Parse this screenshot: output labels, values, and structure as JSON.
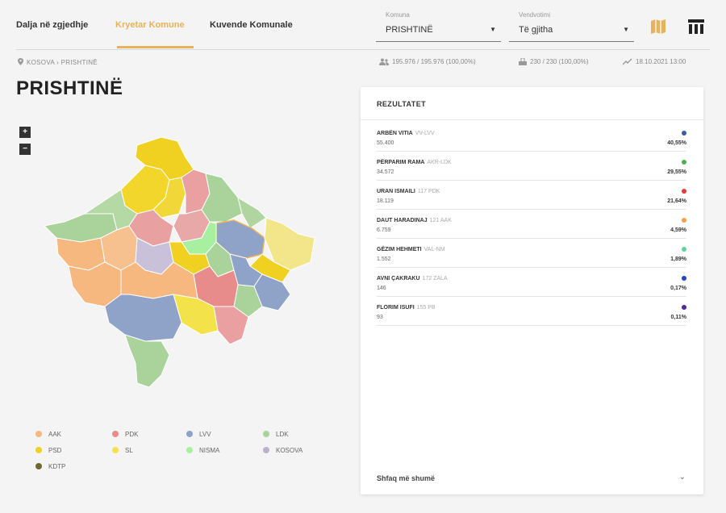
{
  "nav": {
    "tabs": [
      "Dalja në zgjedhje",
      "Kryetar Komune",
      "Kuvende Komunale"
    ],
    "active_tab": 1,
    "komuna": {
      "caption": "Komuna",
      "value": "PRISHTINË"
    },
    "vendvotimi": {
      "caption": "Vendvotimi",
      "value": "Të gjitha"
    },
    "map_icon": "map-icon",
    "table_icon": "table-icon"
  },
  "breadcrumb": "KOSOVA › PRISHTINË",
  "stats": {
    "voters": "195.976 / 195.976 (100,00%)",
    "stations": "230 / 230 (100,00%)",
    "updated": "18.10.2021 13:00"
  },
  "page_title": "PRISHTINË",
  "zoom": {
    "plus": "+",
    "minus": "−"
  },
  "legend": [
    {
      "label": "AAK",
      "color": "#f7b87f"
    },
    {
      "label": "PDK",
      "color": "#e88b8b"
    },
    {
      "label": "LVV",
      "color": "#8fa3c9"
    },
    {
      "label": "LDK",
      "color": "#a9d39a"
    },
    {
      "label": "PSD",
      "color": "#f0d020"
    },
    {
      "label": "SL",
      "color": "#f3e24a"
    },
    {
      "label": "NISMA",
      "color": "#a7f0a0"
    },
    {
      "label": "KOSOVA",
      "color": "#b9b0d0"
    },
    {
      "label": "KDTP",
      "color": "#6a6a30"
    }
  ],
  "panel": {
    "title": "REZULTATET",
    "show_all": "Shfaq më shumë",
    "results": [
      {
        "name": "ARBËN VITIA",
        "party": "VV-LVV",
        "votes": "55.400",
        "pct": "40,55%",
        "color": "#3b5ba5"
      },
      {
        "name": "PËRPARIM RAMA",
        "party": "AKR-LDK",
        "votes": "34.572",
        "pct": "29,55%",
        "color": "#4caf50"
      },
      {
        "name": "URAN ISMAILI",
        "party": "117 PDK",
        "votes": "18.119",
        "pct": "21,64%",
        "color": "#e53935"
      },
      {
        "name": "DAUT HARADINAJ",
        "party": "121 AAK",
        "votes": "6.759",
        "pct": "4,59%",
        "color": "#f5a04a"
      },
      {
        "name": "GËZIM HEHMETI",
        "party": "VAL-NM",
        "votes": "1.552",
        "pct": "1,89%",
        "color": "#5fd39b"
      },
      {
        "name": "AVNI ÇAKRAKU",
        "party": "172 ZALA",
        "votes": "146",
        "pct": "0,17%",
        "color": "#2741c9"
      },
      {
        "name": "FLORIM ISUFI",
        "party": "155 PB",
        "votes": "93",
        "pct": "0,11%",
        "color": "#4a2a9a"
      }
    ]
  }
}
